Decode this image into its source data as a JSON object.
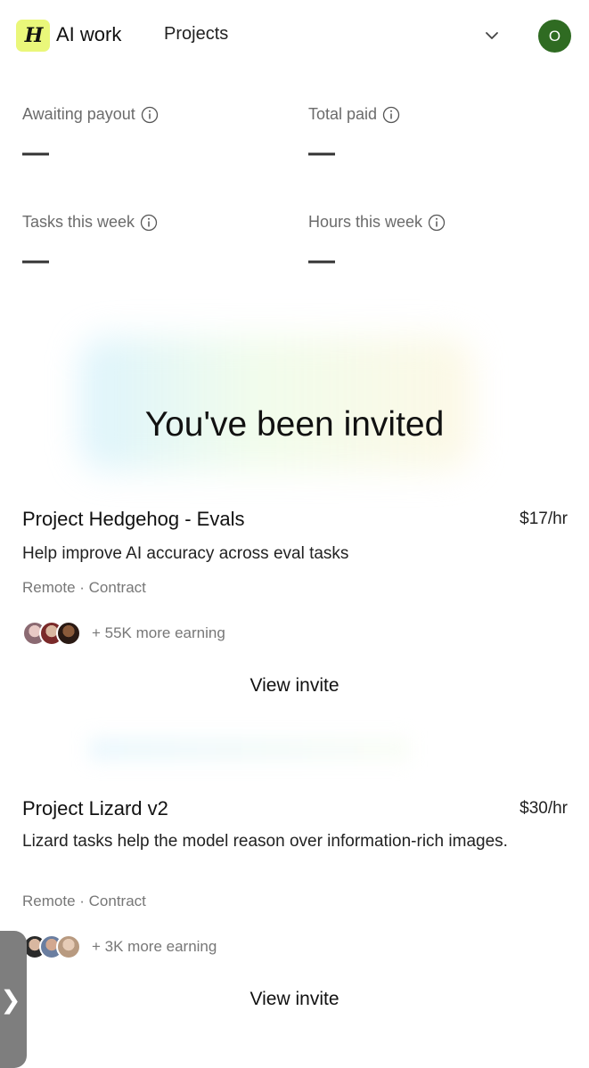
{
  "header": {
    "logo_letter": "H",
    "brand": "AI work",
    "nav_item": "Projects",
    "avatar_initial": "O",
    "colors": {
      "logo_bg": "#eaf77a",
      "avatar_bg": "#2f6b22"
    }
  },
  "stats": [
    {
      "label": "Awaiting payout",
      "value": "—"
    },
    {
      "label": "Total paid",
      "value": "—"
    },
    {
      "label": "Tasks this week",
      "value": "—"
    },
    {
      "label": "Hours this week",
      "value": "—"
    }
  ],
  "invite_title": "You've been invited",
  "projects": [
    {
      "title": "Project Hedgehog - Evals",
      "rate": "$17/hr",
      "description": "Help improve AI accuracy across eval tasks",
      "meta": "Remote · Contract",
      "earning": "+ 55K more earning",
      "cta": "View invite"
    },
    {
      "title": "Project Lizard v2",
      "rate": "$30/hr",
      "description": "Lizard tasks help the model reason over information-rich images.",
      "meta": "Remote · Contract",
      "earning": "+ 3K more earning",
      "cta": "View invite"
    }
  ],
  "side_handle": {
    "glyph": "❯"
  }
}
